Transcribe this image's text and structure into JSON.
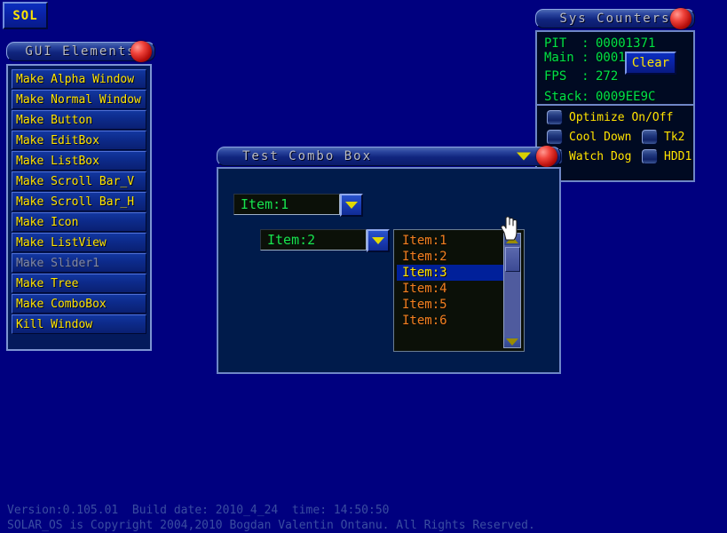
{
  "desktop": {
    "background_color": "#00007f"
  },
  "taskbar": {
    "sol_label": "SOL"
  },
  "gui_panel": {
    "title": "GUI Elements",
    "items": [
      {
        "label": "Make Alpha Window",
        "disabled": false
      },
      {
        "label": "Make Normal Window",
        "disabled": false
      },
      {
        "label": "Make Button",
        "disabled": false
      },
      {
        "label": "Make EditBox",
        "disabled": false
      },
      {
        "label": "Make ListBox",
        "disabled": false
      },
      {
        "label": "Make Scroll Bar_V",
        "disabled": false
      },
      {
        "label": "Make Scroll Bar_H",
        "disabled": false
      },
      {
        "label": "Make Icon",
        "disabled": false
      },
      {
        "label": "Make ListView",
        "disabled": false
      },
      {
        "label": "Make Slider1",
        "disabled": true
      },
      {
        "label": "Make Tree",
        "disabled": false
      },
      {
        "label": "Make ComboBox",
        "disabled": false
      },
      {
        "label": "Kill Window",
        "disabled": false
      }
    ]
  },
  "sys_counters": {
    "title": "Sys Counters",
    "pit_label": "PIT  :",
    "pit_value": "00001371",
    "main_label": "Main :",
    "main_value": "0001262C",
    "fps_label": "FPS  :",
    "fps_value": "272",
    "clear_label": "Clear",
    "stack_label": "Stack:",
    "stack_value": "0009EE9C",
    "checkboxes": [
      {
        "label": "Optimize On/Off",
        "checked": false
      },
      {
        "label": "Cool Down",
        "checked": false
      },
      {
        "label": "Watch Dog",
        "checked": false
      },
      {
        "label": "Tk2",
        "checked": false
      },
      {
        "label": "HDD1",
        "checked": false
      }
    ]
  },
  "combo_window": {
    "title": "Test Combo Box",
    "combo1_value": "Item:1",
    "combo2_value": "Item:2",
    "combo3_value": "Item:3",
    "dropdown_items": [
      {
        "label": "Item:1",
        "selected": false
      },
      {
        "label": "Item:2",
        "selected": false
      },
      {
        "label": "Item:3",
        "selected": true
      },
      {
        "label": "Item:4",
        "selected": false
      },
      {
        "label": "Item:5",
        "selected": false
      },
      {
        "label": "Item:6",
        "selected": false
      }
    ]
  },
  "footer": {
    "line1": "Version:0.105.01  Build date: 2010_4_24  time: 14:50:50",
    "line2": "SOLAR_OS is Copyright 2004,2010 Bogdan Valentin Ontanu. All Rights Reserved."
  },
  "colors": {
    "desktop": "#00007f",
    "accent_yellow": "#ffe400",
    "counter_green": "#00e04a",
    "combo_green": "#19e24d",
    "dropdown_orange": "#f08020",
    "close_orb_red": "#f0443c"
  }
}
